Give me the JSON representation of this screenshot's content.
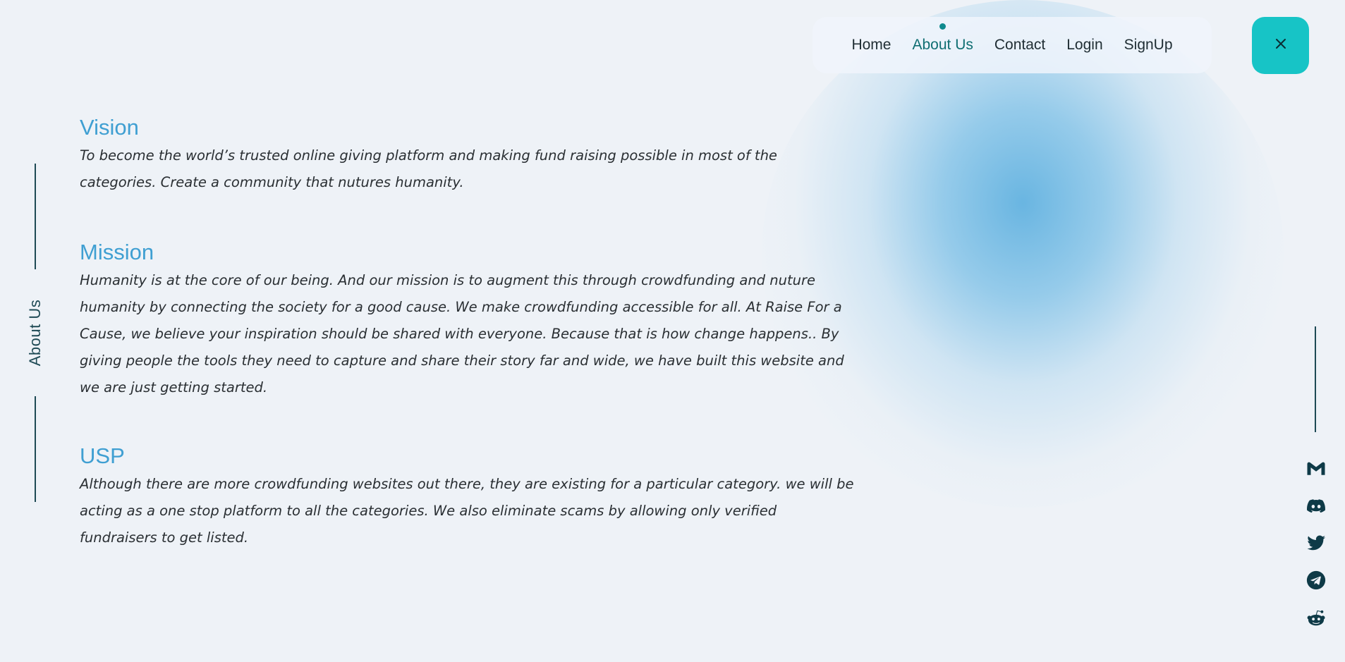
{
  "nav": {
    "items": [
      {
        "label": "Home",
        "active": false
      },
      {
        "label": "About Us",
        "active": true
      },
      {
        "label": "Contact",
        "active": false
      },
      {
        "label": "Login",
        "active": false
      },
      {
        "label": "SignUp",
        "active": false
      }
    ],
    "close_label": "X"
  },
  "side_label": "About Us",
  "sections": {
    "vision": {
      "title": "Vision",
      "body": "To become the world’s trusted online giving platform and making fund raising possible in most of the categories. Create a community that nutures humanity."
    },
    "mission": {
      "title": "Mission",
      "body": "Humanity is at the core of our being. And our mission is to augment this through crowdfunding and nuture humanity by connecting the society for a good cause. We make crowdfunding accessible for all. At Raise For a Cause, we believe your inspiration should be shared with everyone. Because that is how change happens.. By giving people the tools they need to capture and share their story far and wide, we have built this website and we are just getting started."
    },
    "usp": {
      "title": "USP",
      "body": "Although there are more crowdfunding websites out there, they are existing for a particular category. we will be acting as a one stop platform to all the categories. We also eliminate scams by allowing only verified fundraisers to get listed."
    }
  },
  "social_icons": [
    "gmail-icon",
    "discord-icon",
    "twitter-icon",
    "telegram-icon",
    "reddit-icon"
  ],
  "colors": {
    "background": "#eef2f7",
    "accent_teal": "#17c4c6",
    "heading_blue": "#3f9fd2",
    "dark_teal": "#1e4a55"
  }
}
